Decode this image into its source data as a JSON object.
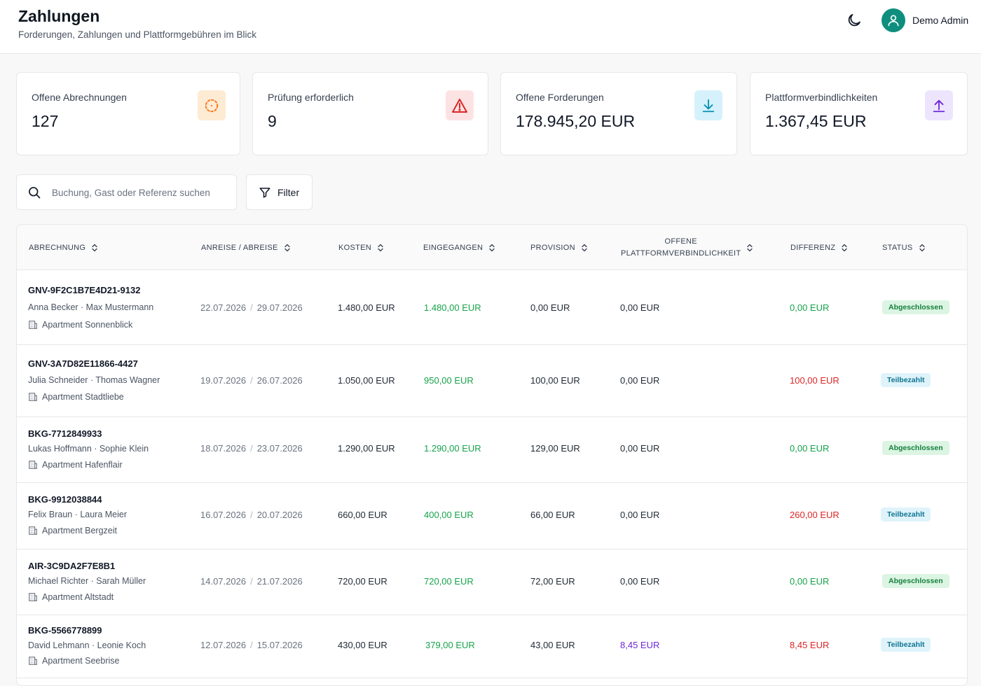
{
  "header": {
    "title": "Zahlungen",
    "subtitle": "Forderungen, Zahlungen und Plattformgebühren im Blick",
    "user_name": "Demo Admin"
  },
  "cards": [
    {
      "label": "Offene Abrechnungen",
      "value": "127",
      "icon": "pending-dashed-circle-icon",
      "color": "#f97316",
      "bg": "#fdebd3"
    },
    {
      "label": "Prüfung erforderlich",
      "value": "9",
      "icon": "warning-triangle-icon",
      "color": "#dc2626",
      "bg": "#fde2e4"
    },
    {
      "label": "Offene Forderungen",
      "value": "178.945,20 EUR",
      "icon": "download-arrow-icon",
      "color": "#0891b2",
      "bg": "#d5f1fb"
    },
    {
      "label": "Plattformverbindlichkeiten",
      "value": "1.367,45 EUR",
      "icon": "upload-arrow-icon",
      "color": "#6d28d9",
      "bg": "#ede5fd"
    }
  ],
  "search": {
    "placeholder": "Buchung, Gast oder Referenz suchen",
    "value": ""
  },
  "filter": {
    "label": "Filter"
  },
  "table": {
    "columns": [
      {
        "key": "abrechnung",
        "label": "ABRECHNUNG"
      },
      {
        "key": "anreise",
        "label": "ANREISE / ABREISE"
      },
      {
        "key": "kosten",
        "label": "KOSTEN"
      },
      {
        "key": "eingegangen",
        "label": "EINGEGANGEN"
      },
      {
        "key": "provision",
        "label": "PROVISION"
      },
      {
        "key": "offene",
        "label_line1": "OFFENE",
        "label_line2": "PLATTFORMVERBINDLICHKEIT"
      },
      {
        "key": "differenz",
        "label": "DIFFERENZ"
      },
      {
        "key": "status",
        "label": "STATUS"
      }
    ],
    "rows": [
      {
        "ref": "GNV-9F2C1B7E4D21-9132",
        "guests": "Anna Becker · Max Mustermann",
        "apartment": "Apartment Sonnenblick",
        "arrival": "22.07.2026",
        "departure": "29.07.2026",
        "kosten": "1.480,00 EUR",
        "eingegangen": "1.480,00 EUR",
        "provision": "0,00 EUR",
        "offene": "0,00 EUR",
        "offene_color": "default",
        "differenz": "0,00 EUR",
        "differenz_color": "green",
        "status": "Abgeschlossen",
        "status_type": "done"
      },
      {
        "ref": "GNV-3A7D82E11866-4427",
        "guests": "Julia Schneider · Thomas Wagner",
        "apartment": "Apartment Stadtliebe",
        "arrival": "19.07.2026",
        "departure": "26.07.2026",
        "kosten": "1.050,00 EUR",
        "eingegangen": "950,00 EUR",
        "provision": "100,00 EUR",
        "offene": "0,00 EUR",
        "offene_color": "default",
        "differenz": "100,00 EUR",
        "differenz_color": "red",
        "status": "Teilbezahlt",
        "status_type": "partial"
      },
      {
        "ref": "BKG-7712849933",
        "guests": "Lukas Hoffmann · Sophie Klein",
        "apartment": "Apartment Hafenflair",
        "arrival": "18.07.2026",
        "departure": "23.07.2026",
        "kosten": "1.290,00 EUR",
        "eingegangen": "1.290,00 EUR",
        "provision": "129,00 EUR",
        "offene": "0,00 EUR",
        "offene_color": "default",
        "differenz": "0,00 EUR",
        "differenz_color": "green",
        "status": "Abgeschlossen",
        "status_type": "done"
      },
      {
        "ref": "BKG-9912038844",
        "guests": "Felix Braun · Laura Meier",
        "apartment": "Apartment Bergzeit",
        "arrival": "16.07.2026",
        "departure": "20.07.2026",
        "kosten": "660,00 EUR",
        "eingegangen": "400,00 EUR",
        "provision": "66,00 EUR",
        "offene": "0,00 EUR",
        "offene_color": "default",
        "differenz": "260,00 EUR",
        "differenz_color": "red",
        "status": "Teilbezahlt",
        "status_type": "partial"
      },
      {
        "ref": "AIR-3C9DA2F7E8B1",
        "guests": "Michael Richter · Sarah Müller",
        "apartment": "Apartment Altstadt",
        "arrival": "14.07.2026",
        "departure": "21.07.2026",
        "kosten": "720,00 EUR",
        "eingegangen": "720,00 EUR",
        "provision": "72,00 EUR",
        "offene": "0,00 EUR",
        "offene_color": "default",
        "differenz": "0,00 EUR",
        "differenz_color": "green",
        "status": "Abgeschlossen",
        "status_type": "done"
      },
      {
        "ref": "BKG-5566778899",
        "guests": "David Lehmann · Leonie Koch",
        "apartment": "Apartment Seebrise",
        "arrival": "12.07.2026",
        "departure": "15.07.2026",
        "kosten": "430,00 EUR",
        "eingegangen": "379,00 EUR",
        "provision": "43,00 EUR",
        "offene": "8,45 EUR",
        "offene_color": "purple",
        "differenz": "8,45 EUR",
        "differenz_color": "red",
        "status": "Teilbezahlt",
        "status_type": "partial"
      }
    ]
  }
}
